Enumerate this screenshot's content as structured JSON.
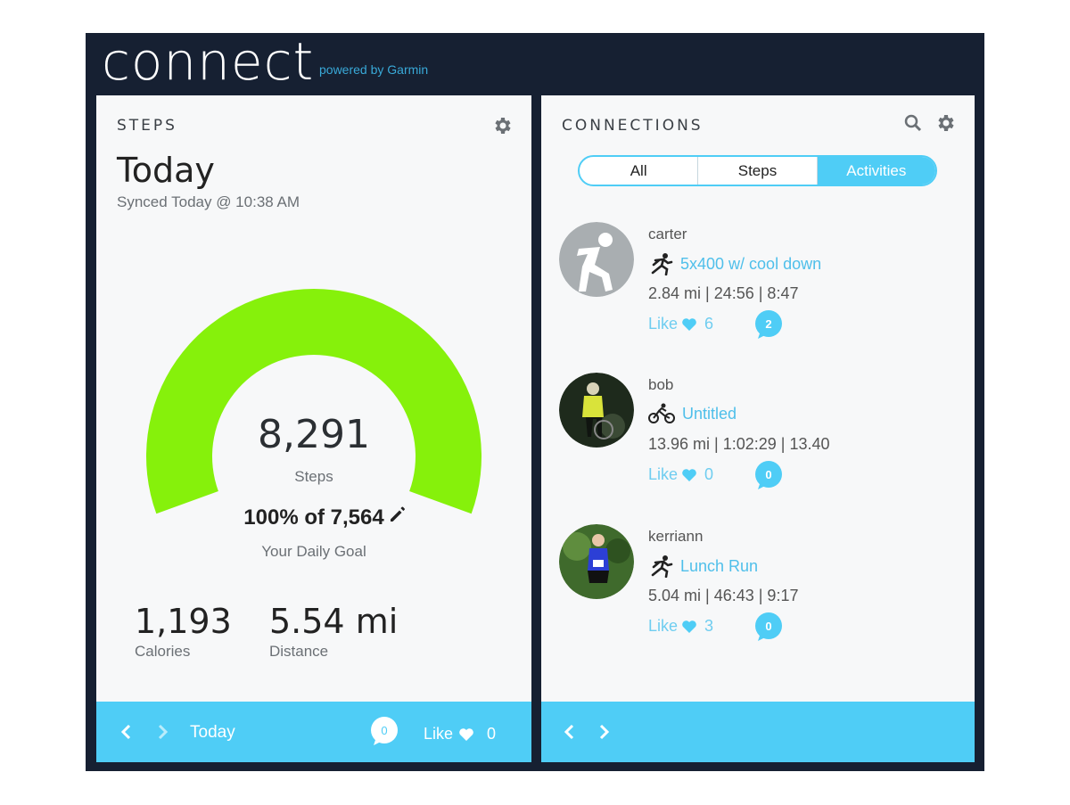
{
  "app": {
    "logo": "connect",
    "powered_by": "powered by Garmin"
  },
  "colors": {
    "frame": "#162032",
    "accent": "#4fcdf6",
    "gauge_green": "#86f10b",
    "link_blue": "#4fbfea"
  },
  "steps_panel": {
    "title": "STEPS",
    "settings_icon": "gear-icon",
    "day": "Today",
    "synced": "Synced Today @ 10:38 AM",
    "progress": 1.0,
    "steps": "8,291",
    "steps_label": "Steps",
    "goal_text": "100% of 7,564",
    "goal_label": "Your Daily Goal",
    "calories": {
      "value": "1,193",
      "label": "Calories"
    },
    "distance": {
      "value": "5.54 mi",
      "label": "Distance"
    },
    "footer": {
      "day_label": "Today",
      "comments": "0",
      "like_label": "Like",
      "likes": "0"
    }
  },
  "connections_panel": {
    "title": "CONNECTIONS",
    "search_icon": "search-icon",
    "settings_icon": "gear-icon",
    "tabs": [
      {
        "label": "All",
        "active": false
      },
      {
        "label": "Steps",
        "active": false
      },
      {
        "label": "Activities",
        "active": true
      }
    ],
    "feed": [
      {
        "user": "carter",
        "activity_icon": "running-icon",
        "activity": "5x400 w/ cool down",
        "metrics": "2.84 mi | 24:56 | 8:47",
        "like_label": "Like",
        "likes": "6",
        "comments": "2"
      },
      {
        "user": "bob",
        "activity_icon": "cycling-icon",
        "activity": "Untitled",
        "metrics": "13.96 mi | 1:02:29 | 13.40",
        "like_label": "Like",
        "likes": "0",
        "comments": "0"
      },
      {
        "user": "kerriann",
        "activity_icon": "running-icon",
        "activity": "Lunch Run",
        "metrics": "5.04 mi | 46:43 | 9:17",
        "like_label": "Like",
        "likes": "3",
        "comments": "0"
      }
    ]
  }
}
